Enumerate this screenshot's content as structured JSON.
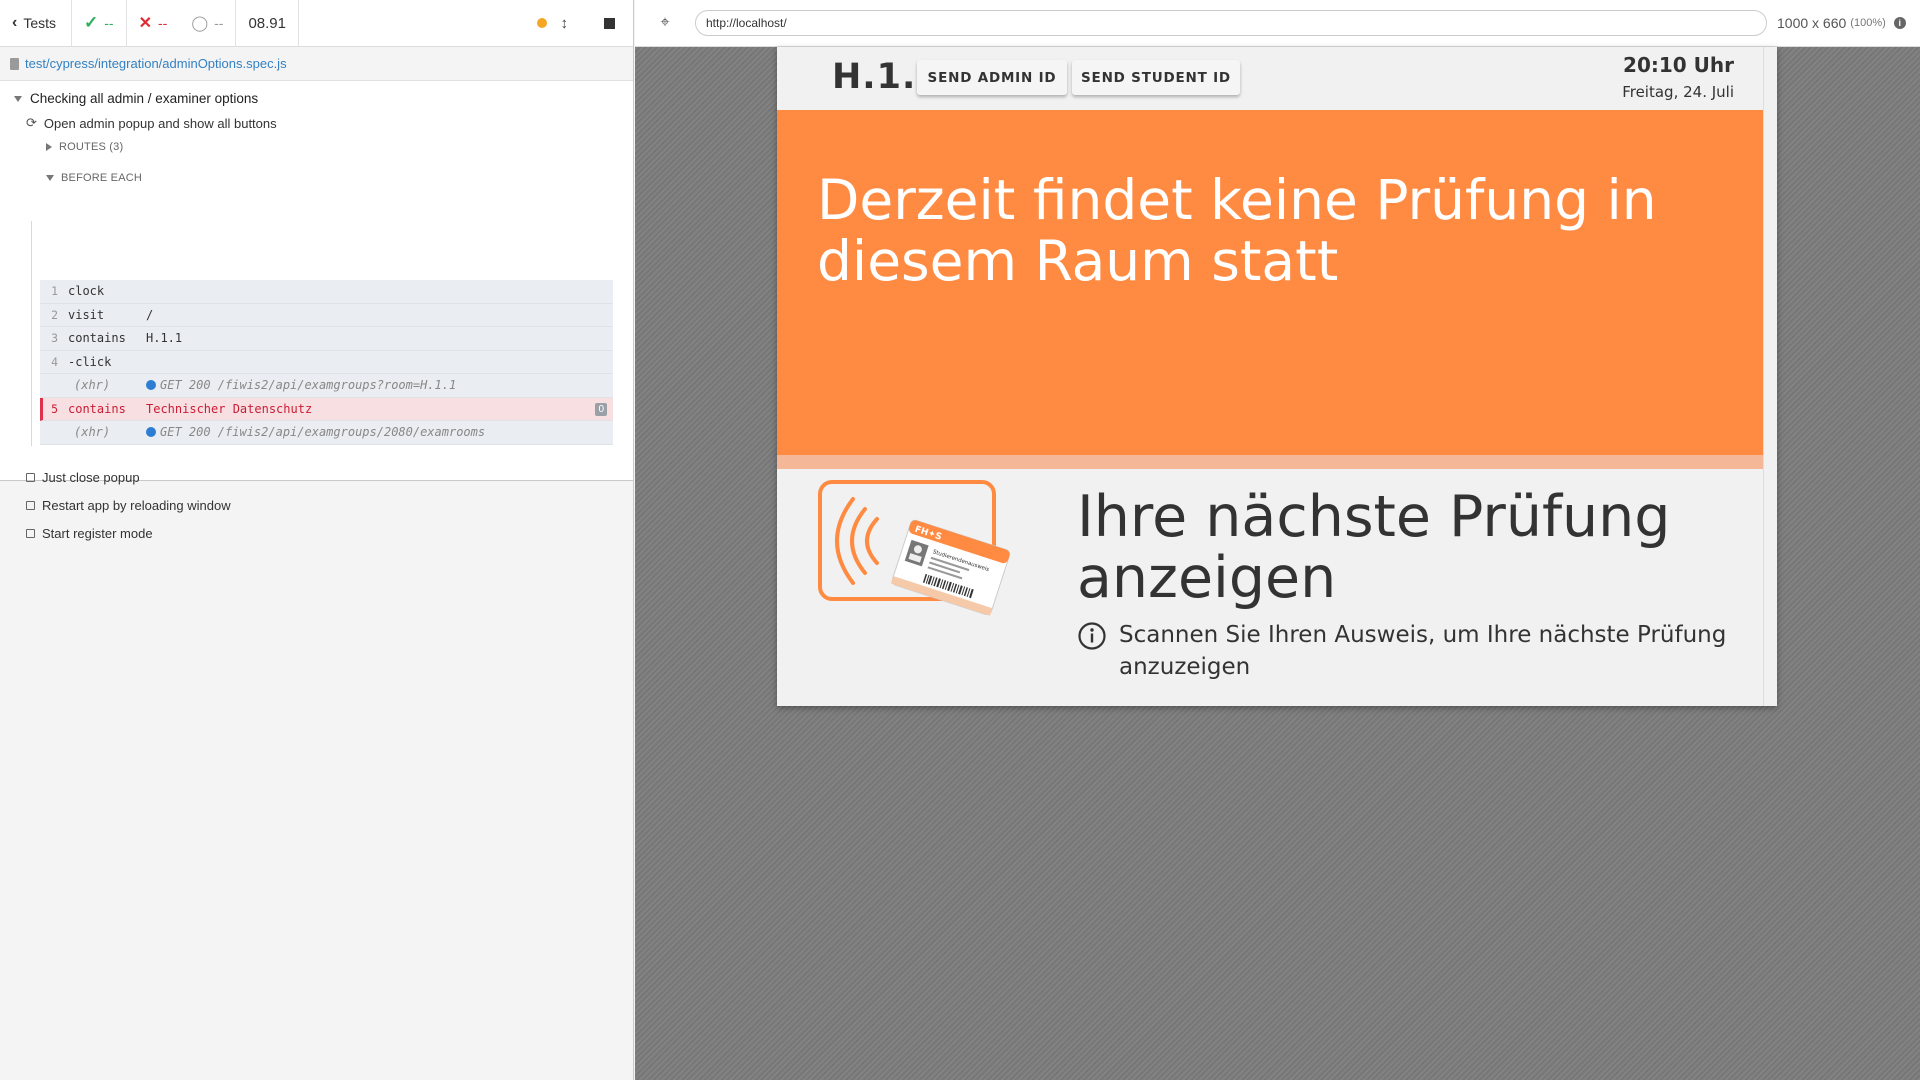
{
  "reporter": {
    "back_label": "Tests",
    "passed": "--",
    "failed": "--",
    "pending": "--",
    "duration": "08.91",
    "spec_path": "test/cypress/integration/adminOptions.spec.js",
    "suite_title": "Checking all admin / examiner options",
    "tests": [
      "Open admin popup and show all buttons",
      "Just close popup",
      "Restart app by reloading window",
      "Start register mode"
    ],
    "hooks": {
      "routes": "ROUTES (3)",
      "before_each": "BEFORE EACH"
    },
    "commands": [
      {
        "num": "1",
        "name": "clock",
        "msg": ""
      },
      {
        "num": "2",
        "name": "visit",
        "msg": "/"
      },
      {
        "num": "3",
        "name": "contains",
        "msg": "H.1.1"
      },
      {
        "num": "4",
        "name": "-click",
        "msg": ""
      },
      {
        "num": "",
        "name": "(xhr)",
        "msg": "GET 200 /fiwis2/api/examgroups?room=H.1.1"
      },
      {
        "num": "5",
        "name": "contains",
        "msg": "Technischer Datenschutz",
        "badge": "0"
      },
      {
        "num": "",
        "name": "(xhr)",
        "msg": "GET 200 /fiwis2/api/examgroups/2080/examrooms"
      }
    ]
  },
  "browser": {
    "url": "http://localhost/",
    "viewport": "1000 x 660",
    "zoom": "(100%)"
  },
  "app": {
    "room": "H.1.1",
    "send_admin_label": "SEND ADMIN ID",
    "send_student_label": "SEND STUDENT ID",
    "time": "20:10 Uhr",
    "date": "Freitag, 24. Juli",
    "banner_text": "Derzeit findet keine Prüfung in diesem Raum statt",
    "next_title": "Ihre nächste Prüfung anzeigen",
    "scan_hint": "Scannen Sie Ihren Ausweis, um Ihre nächste Prüfung anzuzeigen",
    "card_brand": "FH✦S",
    "card_title": "Studierendenausweis",
    "colors": {
      "banner": "#ff8b43",
      "pass": "#2fae5b",
      "fail": "#e02b35",
      "link": "#3380c3"
    }
  }
}
